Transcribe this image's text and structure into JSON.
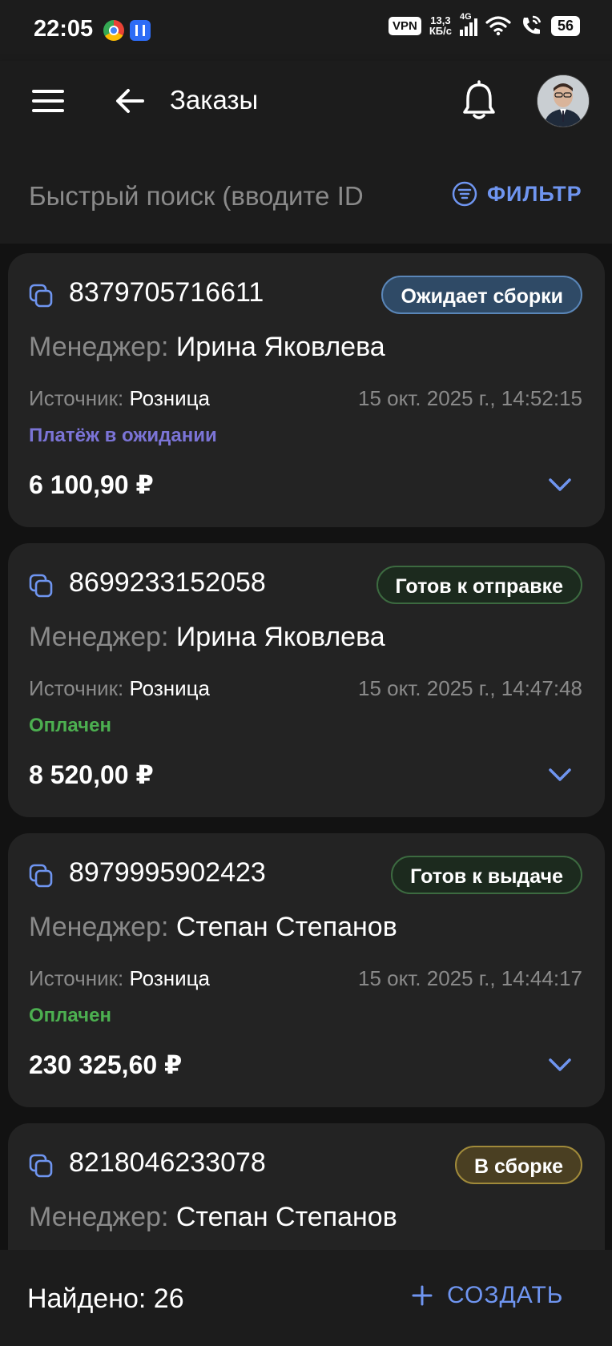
{
  "status_bar": {
    "time": "22:05",
    "vpn": "VPN",
    "speed_value": "13,3",
    "speed_unit": "КБ/с",
    "network": "4G",
    "battery": "56"
  },
  "appbar": {
    "title": "Заказы"
  },
  "search": {
    "placeholder": "Быстрый поиск (вводите ID",
    "filter_label": "ФИЛЬТР"
  },
  "orders": [
    {
      "id": "8379705716611",
      "status": "Ожидает сборки",
      "manager_label": "Менеджер:",
      "manager": "Ирина Яковлева",
      "source_label": "Источник:",
      "source": "Розница",
      "datetime": "15 окт. 2025 г., 14:52:15",
      "payment": "Платёж в ожидании",
      "amount": "6 100,90 ₽"
    },
    {
      "id": "8699233152058",
      "status": "Готов к отправке",
      "manager_label": "Менеджер:",
      "manager": "Ирина Яковлева",
      "source_label": "Источник:",
      "source": "Розница",
      "datetime": "15 окт. 2025 г., 14:47:48",
      "payment": "Оплачен",
      "amount": "8 520,00 ₽"
    },
    {
      "id": "8979995902423",
      "status": "Готов к выдаче",
      "manager_label": "Менеджер:",
      "manager": "Степан Степанов",
      "source_label": "Источник:",
      "source": "Розница",
      "datetime": "15 окт. 2025 г., 14:44:17",
      "payment": "Оплачен",
      "amount": "230 325,60 ₽"
    },
    {
      "id": "8218046233078",
      "status": "В сборке",
      "manager_label": "Менеджер:",
      "manager": "Степан Степанов"
    }
  ],
  "bottom_bar": {
    "found": "Найдено: 26",
    "create_label": "СОЗДАТЬ"
  },
  "colors": {
    "accent": "#6f95f0",
    "payment_pending": "#7b74d6",
    "payment_paid": "#4caf50",
    "badge_blue_bg": "#2f4a66",
    "badge_blue_border": "#5a86b8",
    "badge_green_bg": "#1c2a1e",
    "badge_green_border": "#3c6a40",
    "badge_yellow_bg": "#4a3f22",
    "badge_yellow_border": "#a08a3a"
  }
}
